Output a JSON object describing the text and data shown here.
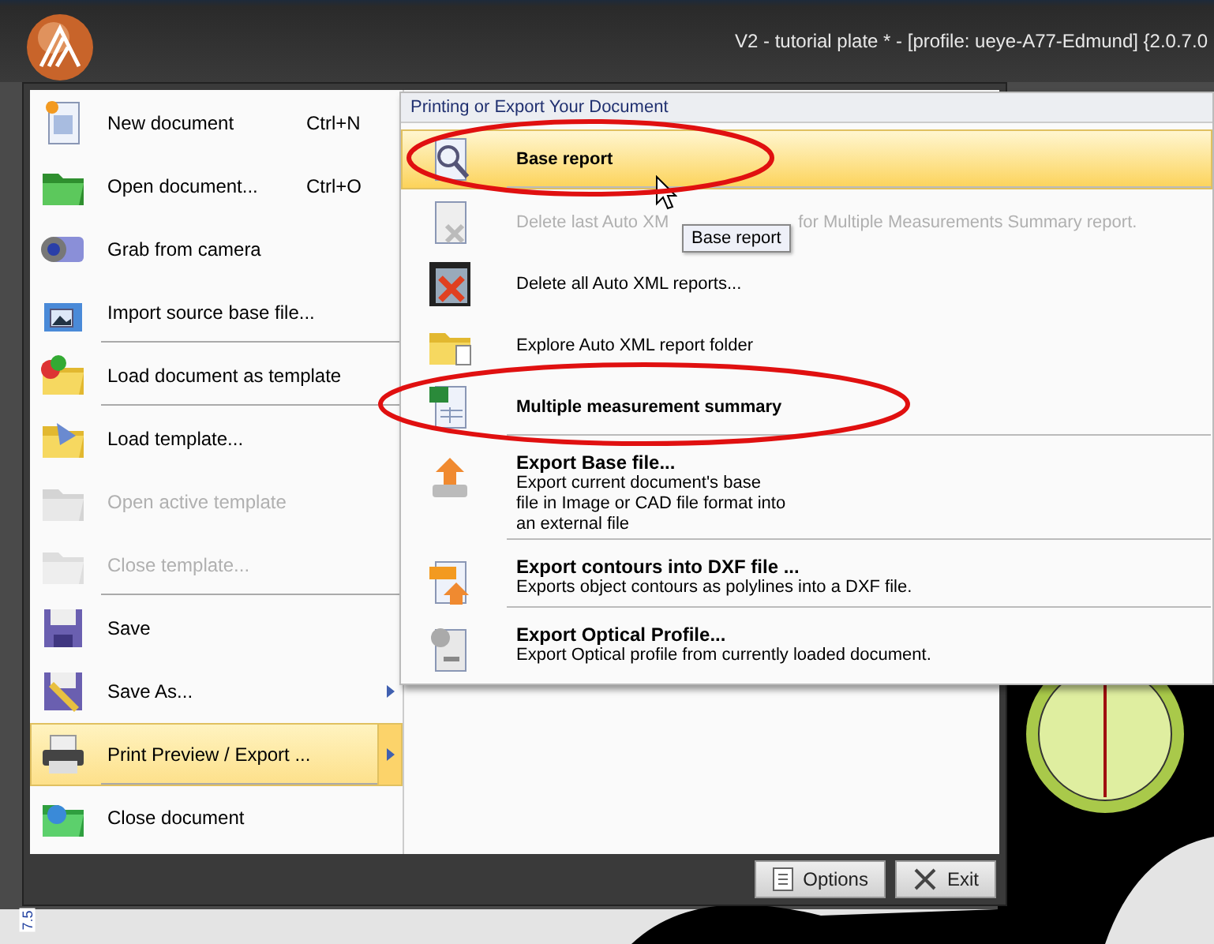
{
  "window": {
    "title": "V2 - tutorial plate * - [profile: ueye-A77-Edmund] {2.0.7.0"
  },
  "menu": {
    "items": [
      {
        "label": "New document",
        "shortcut": "Ctrl+N",
        "disabled": false,
        "selected": false,
        "submenu": false,
        "separator_after": false
      },
      {
        "label": "Open document...",
        "shortcut": "Ctrl+O",
        "disabled": false,
        "selected": false,
        "submenu": false,
        "separator_after": false
      },
      {
        "label": "Grab from camera",
        "disabled": false,
        "selected": false,
        "submenu": false,
        "separator_after": false
      },
      {
        "label": "Import source base file...",
        "disabled": false,
        "selected": false,
        "submenu": false,
        "separator_after": true
      },
      {
        "label": "Load document as template",
        "disabled": false,
        "selected": false,
        "submenu": false,
        "separator_after": true
      },
      {
        "label": "Load template...",
        "disabled": false,
        "selected": false,
        "submenu": false,
        "separator_after": false
      },
      {
        "label": "Open active template",
        "disabled": true,
        "selected": false,
        "submenu": false,
        "separator_after": false
      },
      {
        "label": "Close template...",
        "disabled": true,
        "selected": false,
        "submenu": false,
        "separator_after": true
      },
      {
        "label": "Save",
        "disabled": false,
        "selected": false,
        "submenu": false,
        "separator_after": false
      },
      {
        "label": "Save As...",
        "disabled": false,
        "selected": false,
        "submenu": true,
        "separator_after": false
      },
      {
        "label": "Print Preview / Export ...",
        "disabled": false,
        "selected": true,
        "submenu": true,
        "separator_after": true
      },
      {
        "label": "Close document",
        "disabled": false,
        "selected": false,
        "submenu": false,
        "separator_after": false
      }
    ]
  },
  "submenu": {
    "header": "Printing or Export Your Document",
    "items": [
      {
        "kind": "bold",
        "title": "Base report",
        "selected": true,
        "disabled": false,
        "separator_after": true
      },
      {
        "kind": "covered",
        "parts": [
          "Delete last Auto XM",
          "for Multiple Measurements Summary report."
        ],
        "selected": false,
        "disabled": true,
        "separator_after": false
      },
      {
        "kind": "plain",
        "title": "Delete all Auto XML reports...",
        "selected": false,
        "disabled": false,
        "separator_after": false
      },
      {
        "kind": "plain",
        "title": "Explore Auto XML report folder",
        "selected": false,
        "disabled": false,
        "separator_after": false
      },
      {
        "kind": "bold",
        "title": "Multiple measurement summary",
        "selected": false,
        "disabled": false,
        "separator_after": true
      },
      {
        "kind": "detailed",
        "title": "Export Base file...",
        "description": [
          "Export current document's base",
          "file in Image or CAD file format into",
          "an external file"
        ],
        "selected": false,
        "disabled": false,
        "separator_after": true
      },
      {
        "kind": "detailed",
        "title": "Export contours into DXF file ...",
        "description": [
          "Exports object contours as polylines into a DXF file."
        ],
        "selected": false,
        "disabled": false,
        "separator_after": true
      },
      {
        "kind": "detailed",
        "title": "Export Optical Profile...",
        "description": [
          "Export Optical profile from currently loaded document."
        ],
        "selected": false,
        "disabled": false,
        "separator_after": false
      }
    ]
  },
  "tooltip": "Base report",
  "buttons": [
    {
      "kind": "options",
      "label": "Options"
    },
    {
      "kind": "exit",
      "label": "Exit"
    }
  ],
  "ruler_label": "7.5"
}
